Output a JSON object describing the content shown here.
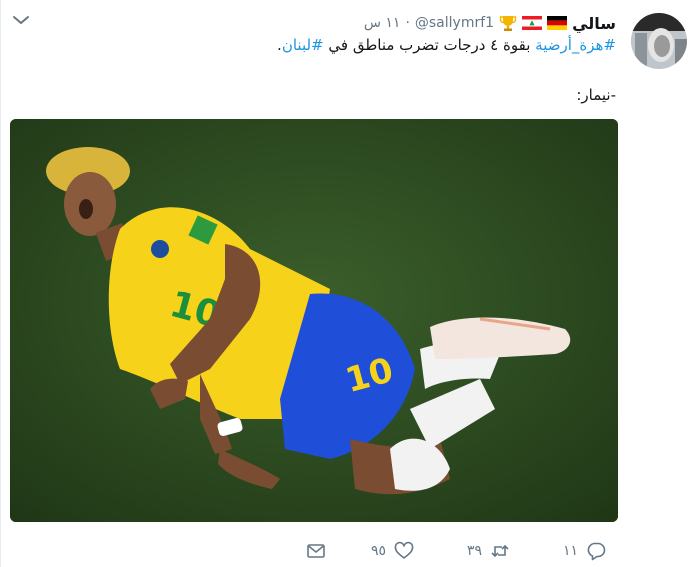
{
  "tweet": {
    "display_name": "سالي",
    "handle": "@sallymrf1",
    "separator": "·",
    "time": "١١ س",
    "text": {
      "hashtag1": "#هزة_أرضية",
      "middle": " بقوة ٤ درجات تضرب مناطق في ",
      "hashtag2": "#لبنان",
      "end": ".",
      "line2": "-نيمار:"
    }
  },
  "actions": {
    "reply_count": "١١",
    "retweet_count": "٣٩",
    "like_count": "٩٥"
  },
  "colors": {
    "hashtag": "#1b95e0",
    "secondary": "#657786",
    "photo_grass": "#2d4a22"
  },
  "icons": [
    "chevron-down-icon",
    "germany-flag-icon",
    "lebanon-flag-icon",
    "trophy-icon",
    "reply-icon",
    "retweet-icon",
    "like-icon",
    "message-icon"
  ]
}
